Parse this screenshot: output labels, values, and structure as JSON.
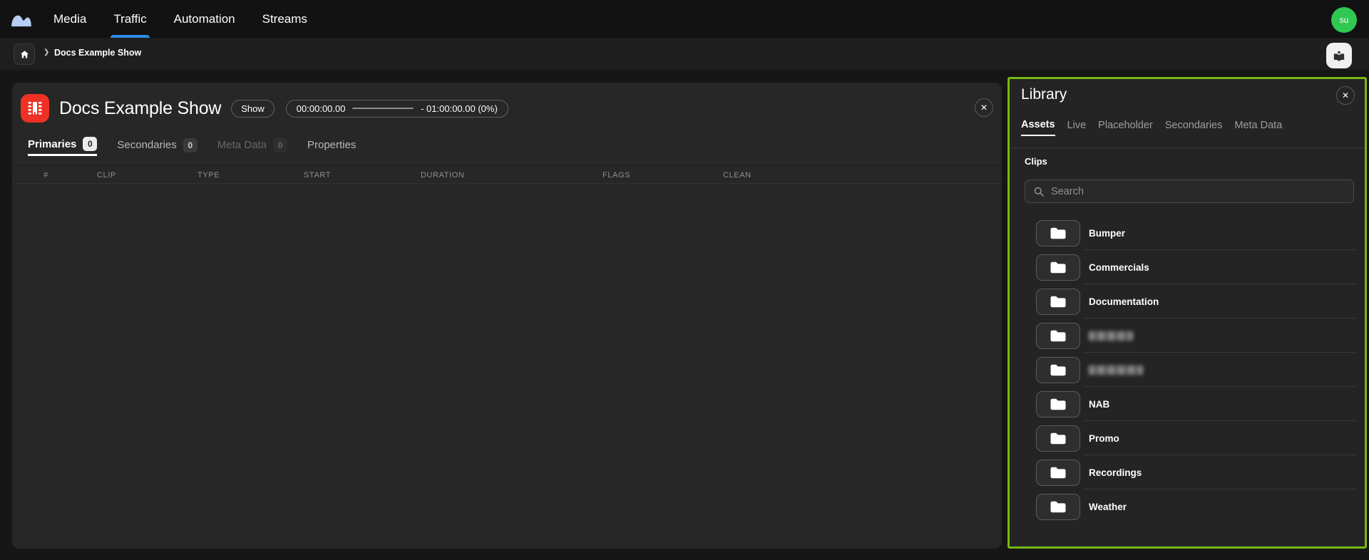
{
  "colors": {
    "accent_blue": "#2e8be6",
    "library_border_green": "#78b814",
    "avatar_green": "#2fc850",
    "show_icon_red": "#ee3124"
  },
  "navbar": {
    "logo_icon": "app-logo",
    "items": [
      {
        "label": "Media",
        "active": false
      },
      {
        "label": "Traffic",
        "active": true
      },
      {
        "label": "Automation",
        "active": false
      },
      {
        "label": "Streams",
        "active": false
      }
    ],
    "avatar_initials": "su"
  },
  "breadcrumb": {
    "home_icon": "home",
    "chevron": "❯",
    "current": "Docs Example Show",
    "library_toggle_icon": "reading-person"
  },
  "show_panel": {
    "icon": "filmstrip",
    "title": "Docs Example Show",
    "type_badge": "Show",
    "time_start": "00:00:00.00",
    "time_end": "- 01:00:00.00 (0%)",
    "close_glyph": "✕",
    "tabs": [
      {
        "label": "Primaries",
        "count": "0",
        "state": "active"
      },
      {
        "label": "Secondaries",
        "count": "0",
        "state": "normal"
      },
      {
        "label": "Meta Data",
        "count": "0",
        "state": "disabled"
      },
      {
        "label": "Properties",
        "state": "normal"
      }
    ],
    "table_columns": [
      "#",
      "CLIP",
      "TYPE",
      "START",
      "DURATION",
      "FLAGS",
      "CLEAN"
    ],
    "rows": []
  },
  "library": {
    "title": "Library",
    "close_glyph": "✕",
    "tabs": [
      {
        "label": "Assets",
        "active": true
      },
      {
        "label": "Live",
        "active": false
      },
      {
        "label": "Placeholder",
        "active": false
      },
      {
        "label": "Secondaries",
        "active": false
      },
      {
        "label": "Meta Data",
        "active": false
      }
    ],
    "section_label": "Clips",
    "search_placeholder": "Search",
    "folders": [
      {
        "label": "Bumper",
        "redacted": false
      },
      {
        "label": "Commercials",
        "redacted": false
      },
      {
        "label": "Documentation",
        "redacted": false
      },
      {
        "label": "",
        "redacted": true
      },
      {
        "label": "",
        "redacted": true
      },
      {
        "label": "NAB",
        "redacted": false
      },
      {
        "label": "Promo",
        "redacted": false
      },
      {
        "label": "Recordings",
        "redacted": false
      },
      {
        "label": "Weather",
        "redacted": false
      }
    ]
  }
}
